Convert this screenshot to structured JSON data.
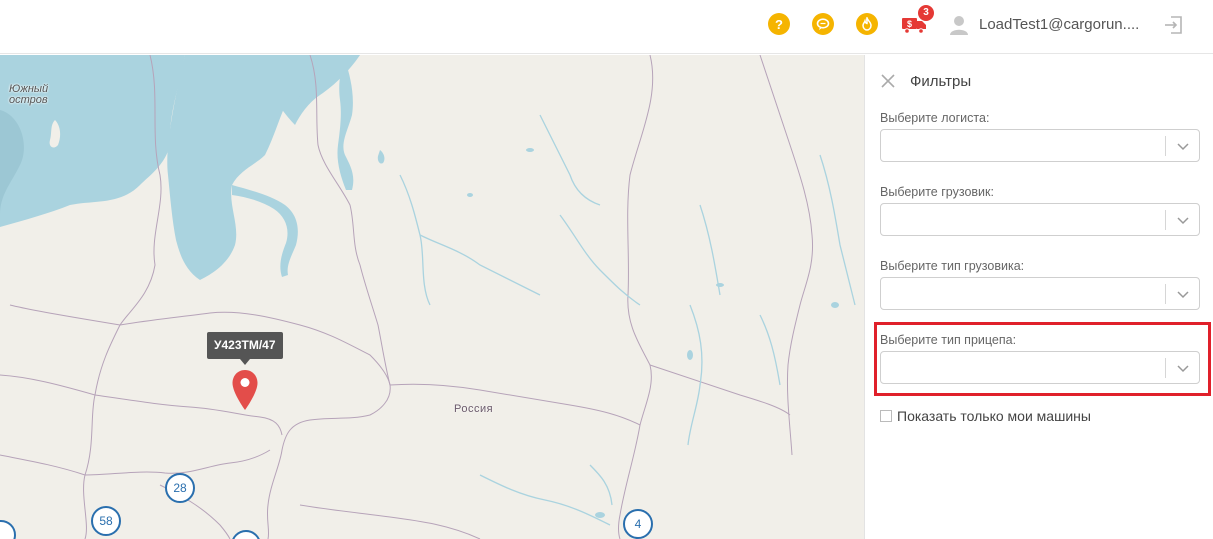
{
  "header": {
    "help_icon": "question-icon",
    "chat_icon": "chat-icon",
    "fire_icon": "fire-icon",
    "truck_icon": "money-truck-icon",
    "notification_count": "3",
    "user_name": "LoadTest1@cargorun....",
    "accent_color": "#f5b400",
    "badge_color": "#e53935"
  },
  "map": {
    "place_label_line1": "Южный",
    "place_label_line2": "остров",
    "country_label": "Россия",
    "marker_tooltip": "У423ТМ/47",
    "marker_color": "#e34d4a",
    "clusters": [
      "28",
      "58",
      "4"
    ]
  },
  "filters": {
    "title": "Фильтры",
    "logist_label": "Выберите логиста:",
    "truck_label": "Выберите грузовик:",
    "truck_type_label": "Выберите тип грузовика:",
    "trailer_type_label": "Выберите тип прицепа:",
    "only_mine_label": "Показать только мои машины",
    "only_mine_checked": false,
    "highlight_color": "#e0202a"
  }
}
